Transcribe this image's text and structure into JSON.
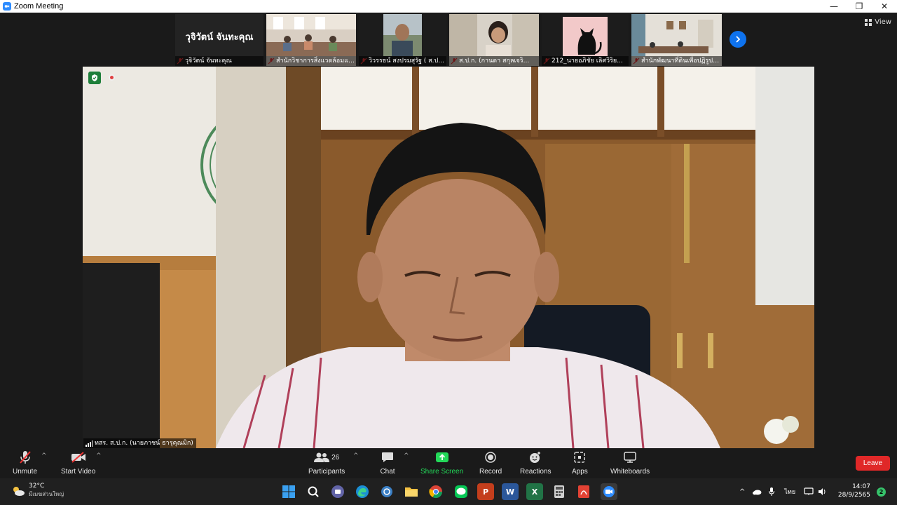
{
  "window": {
    "title": "Zoom Meeting",
    "minimize": "—",
    "maximize": "❐",
    "close": "✕"
  },
  "strip": {
    "view_label": "View",
    "thumbnails": [
      {
        "big_name": "วุจิวัตน์ จันทะคุณ",
        "name": "วุจิวัตน์ จันทะคุณ"
      },
      {
        "name": "สำนักวิชาการสิ่งแวดล้อมและ (ส..."
      },
      {
        "name": "วิวรรธน์ สงปรมสุรัฐ ( ส.ป..."
      },
      {
        "name": "ส.ป.ก. (กานดา สกุลเจริ..."
      },
      {
        "name": "212_นายอภิชัย เลิศวิริย..."
      },
      {
        "name": "สำนักพัฒนาที่ดินเพื่อปฏิรูปที่..."
      }
    ]
  },
  "main": {
    "speaker": "ทสร. ส.ป.ก. (นายภาชน์ ธารุคุณมิก)"
  },
  "toolbar": {
    "unmute": "Unmute",
    "start_video": "Start Video",
    "participants": "Participants",
    "participants_count": "26",
    "chat": "Chat",
    "share_screen": "Share Screen",
    "record": "Record",
    "reactions": "Reactions",
    "apps": "Apps",
    "whiteboards": "Whiteboards",
    "leave": "Leave"
  },
  "taskbar": {
    "temp": "32°C",
    "weather_desc": "มีเมฆส่วนใหญ่",
    "lang": "ไทย",
    "time": "14:07",
    "date": "28/9/2565",
    "notifications": "2",
    "word_letter": "W",
    "excel_letter": "X",
    "ppt_letter": "P"
  }
}
